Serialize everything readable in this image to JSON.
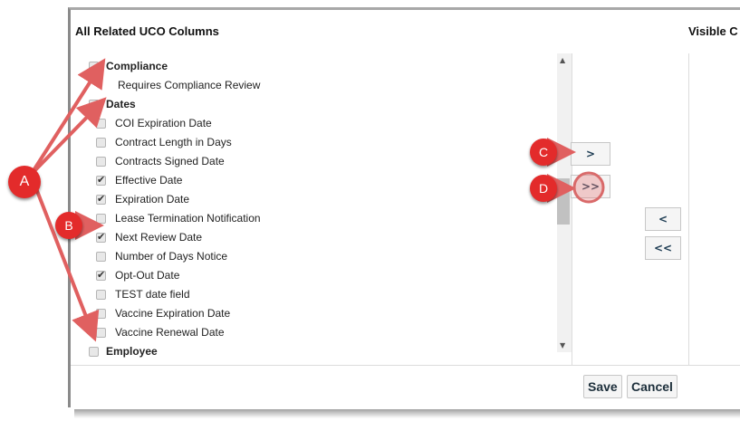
{
  "dialog": {
    "left_title": "All Related UCO Columns",
    "right_title": "Visible C",
    "groups": [
      {
        "label": "Compliance",
        "checked": false,
        "items": [
          {
            "label": "Requires Compliance Review"
          }
        ]
      },
      {
        "label": "Dates",
        "checked": false,
        "items": [
          {
            "label": "COI Expiration Date",
            "checked": false
          },
          {
            "label": "Contract Length in Days",
            "checked": false
          },
          {
            "label": "Contracts Signed Date",
            "checked": false
          },
          {
            "label": "Effective Date",
            "checked": true
          },
          {
            "label": "Expiration Date",
            "checked": true
          },
          {
            "label": "Lease Termination Notification",
            "checked": false
          },
          {
            "label": "Next Review Date",
            "checked": true
          },
          {
            "label": "Number of Days Notice",
            "checked": false
          },
          {
            "label": "Opt-Out Date",
            "checked": true
          },
          {
            "label": "TEST date field",
            "checked": false
          },
          {
            "label": "Vaccine Expiration Date",
            "checked": false
          },
          {
            "label": "Vaccine Renewal Date",
            "checked": false
          }
        ]
      },
      {
        "label": "Employee",
        "checked": false,
        "items": []
      }
    ],
    "buttons": {
      "add": ">",
      "add_all": ">>",
      "remove": "<",
      "remove_all": "<<",
      "save": "Save",
      "cancel": "Cancel"
    }
  },
  "callouts": {
    "a": "A",
    "b": "B",
    "c": "C",
    "d": "D"
  },
  "colors": {
    "callout": "#e32b2b",
    "arrow": "#e06060"
  }
}
